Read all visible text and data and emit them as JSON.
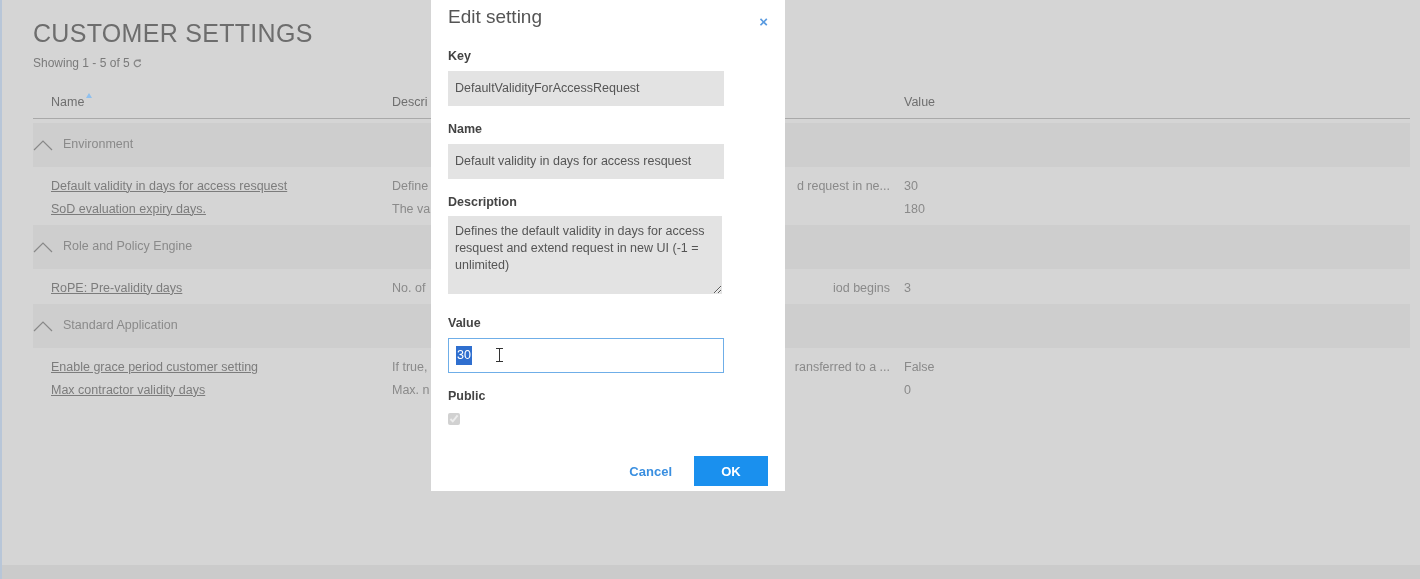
{
  "page": {
    "title": "CUSTOMER SETTINGS",
    "showing": "Showing 1 - 5 of 5"
  },
  "table": {
    "columns": [
      {
        "label": "Name",
        "sorted": true
      },
      {
        "label": "Descri",
        "sorted": false
      },
      {
        "label": "Value",
        "sorted": false
      }
    ],
    "groups": [
      {
        "label": "Environment",
        "expanded": true,
        "rows": [
          {
            "name": "Default validity in days for access resquest",
            "description_start": "Define",
            "description_end": "d request in ne...",
            "value": "30"
          },
          {
            "name": "SoD evaluation expiry days.",
            "description_start": "The va",
            "value": "180"
          }
        ]
      },
      {
        "label": "Role and Policy Engine",
        "expanded": true,
        "rows": [
          {
            "name": "RoPE: Pre-validity days",
            "description_start": "No. of",
            "description_end": "iod begins",
            "value": "3"
          }
        ]
      },
      {
        "label": "Standard Application",
        "expanded": true,
        "rows": [
          {
            "name": "Enable grace period customer setting",
            "description_start": "If true,",
            "description_end": "ransferred to a ...",
            "value": "False"
          },
          {
            "name": "Max contractor validity days",
            "description_start": "Max. n",
            "value": "0"
          }
        ]
      }
    ]
  },
  "dialog": {
    "title": "Edit setting",
    "close": "×",
    "fields": [
      {
        "kind": "readonly",
        "label": "Key",
        "value": "DefaultValidityForAccessRequest"
      },
      {
        "kind": "readonly",
        "label": "Name",
        "value": "Default validity in days for access resquest"
      },
      {
        "kind": "textarea",
        "label": "Description",
        "value": "Defines the default validity in days for access resquest and extend request in new UI (-1 = unlimited)"
      },
      {
        "kind": "input",
        "label": "Value",
        "value": "30",
        "text_selected": true
      },
      {
        "kind": "checkbox",
        "label": "Public",
        "checked": true,
        "disabled": true
      }
    ],
    "buttons": [
      {
        "label": "Cancel",
        "kind": "link"
      },
      {
        "label": "OK",
        "kind": "primary"
      }
    ]
  }
}
